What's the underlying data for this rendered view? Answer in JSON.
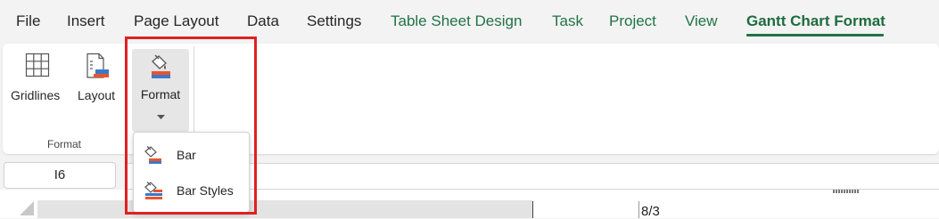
{
  "menu": {
    "tabs": [
      {
        "label": "File"
      },
      {
        "label": "Insert"
      },
      {
        "label": "Page Layout"
      },
      {
        "label": "Data"
      },
      {
        "label": "Settings"
      },
      {
        "label": "Table Sheet Design"
      },
      {
        "label": "Task"
      },
      {
        "label": "Project"
      },
      {
        "label": "View"
      },
      {
        "label": "Gantt Chart Format"
      }
    ],
    "active_tab": "Gantt Chart Format"
  },
  "ribbon": {
    "group_label": "Format",
    "buttons": {
      "gridlines": {
        "label": "Gridlines",
        "icon": "grid-icon"
      },
      "layout": {
        "label": "Layout",
        "icon": "layout-icon"
      },
      "format": {
        "label": "Format",
        "icon": "format-paint-icon",
        "has_dropdown": true
      }
    }
  },
  "format_dropdown": {
    "items": [
      {
        "label": "Bar",
        "icon": "bar-format-icon"
      },
      {
        "label": "Bar Styles",
        "icon": "bar-styles-icon"
      }
    ]
  },
  "formula_bar": {
    "name_box_value": "I6"
  },
  "sheet": {
    "timeline_label": "8/3"
  },
  "colors": {
    "accent_green": "#217346",
    "highlight_red": "#e02020",
    "icon_orange": "#e8552c",
    "icon_blue": "#3c78c8"
  }
}
